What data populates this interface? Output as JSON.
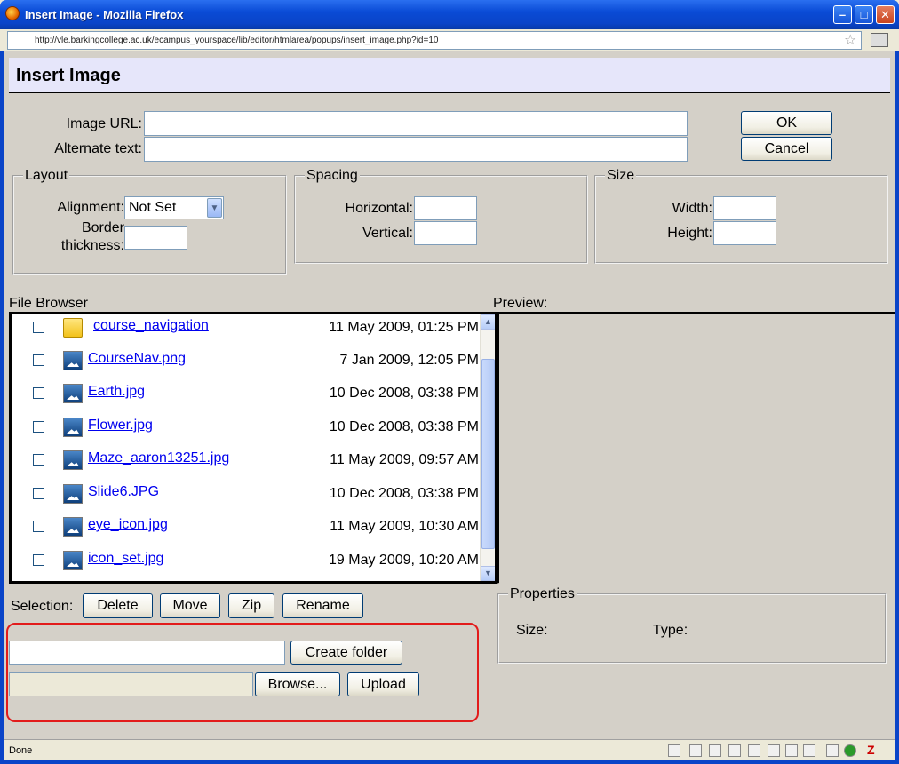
{
  "window": {
    "title": "Insert Image - Mozilla Firefox",
    "url": "http://vle.barkingcollege.ac.uk/ecampus_yourspace/lib/editor/htmlarea/popups/insert_image.php?id=10",
    "minimize": "–",
    "maximize": "□",
    "close": "✕"
  },
  "header": {
    "title": "Insert Image"
  },
  "form": {
    "image_url_label": "Image URL:",
    "alt_text_label": "Alternate text:",
    "image_url_value": "",
    "alt_text_value": "",
    "ok_label": "OK",
    "cancel_label": "Cancel"
  },
  "layout": {
    "legend": "Layout",
    "alignment_label": "Alignment:",
    "alignment_value": "Not Set",
    "border_label_1": "Border",
    "border_label_2": "thickness:"
  },
  "spacing": {
    "legend": "Spacing",
    "horizontal_label": "Horizontal:",
    "vertical_label": "Vertical:"
  },
  "size": {
    "legend": "Size",
    "width_label": "Width:",
    "height_label": "Height:"
  },
  "file_browser": {
    "label": "File Browser",
    "files": [
      {
        "name": "course_navigation",
        "date": "11 May 2009, 01:25 PM",
        "type": "folder"
      },
      {
        "name": "CourseNav.png",
        "date": "7 Jan 2009, 12:05 PM",
        "type": "image"
      },
      {
        "name": "Earth.jpg",
        "date": "10 Dec 2008, 03:38 PM",
        "type": "image"
      },
      {
        "name": "Flower.jpg",
        "date": "10 Dec 2008, 03:38 PM",
        "type": "image"
      },
      {
        "name": "Maze_aaron13251.jpg",
        "date": "11 May 2009, 09:57 AM",
        "type": "image"
      },
      {
        "name": "Slide6.JPG",
        "date": "10 Dec 2008, 03:38 PM",
        "type": "image"
      },
      {
        "name": "eye_icon.jpg",
        "date": "11 May 2009, 10:30 AM",
        "type": "image"
      },
      {
        "name": "icon_set.jpg",
        "date": "19 May 2009, 10:20 AM",
        "type": "image"
      }
    ]
  },
  "preview": {
    "label": "Preview:"
  },
  "selection": {
    "label": "Selection:",
    "delete": "Delete",
    "move": "Move",
    "zip": "Zip",
    "rename": "Rename"
  },
  "properties": {
    "legend": "Properties",
    "size_label": "Size:",
    "type_label": "Type:"
  },
  "upload": {
    "create_folder": "Create folder",
    "browse": "Browse...",
    "upload": "Upload"
  },
  "status": {
    "text": "Done"
  }
}
